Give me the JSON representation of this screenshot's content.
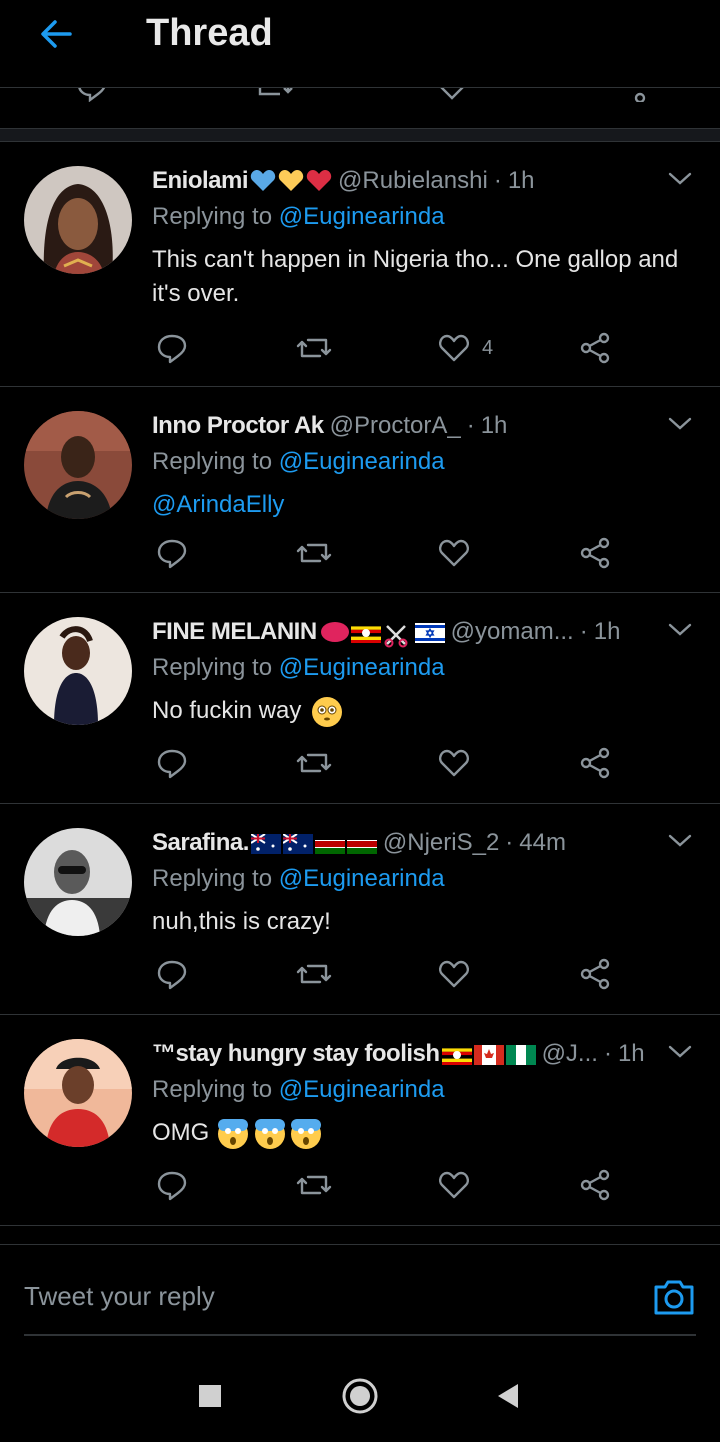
{
  "header": {
    "title": "Thread"
  },
  "tweets": [
    {
      "name": "Eniolami",
      "handle": "@Rubielanshi",
      "time": "1h",
      "replying_to_label": "Replying to",
      "replying_to": "@Euginearinda",
      "text": "This can't happen in Nigeria tho... One gallop and it's over.",
      "like_count": "4"
    },
    {
      "name": "Inno Proctor Ak",
      "handle": "@ProctorA_",
      "time": "1h",
      "replying_to_label": "Replying to",
      "replying_to": "@Euginearinda",
      "text": "@ArindaElly"
    },
    {
      "name": "FINE MELANIN",
      "handle": "@yomam...",
      "time": "1h",
      "replying_to_label": "Replying to",
      "replying_to": "@Euginearinda",
      "text": "No fuckin way"
    },
    {
      "name": "Sarafina.",
      "handle": "@NjeriS_2",
      "time": "44m",
      "replying_to_label": "Replying to",
      "replying_to": "@Euginearinda",
      "text": "nuh,this is crazy!"
    },
    {
      "name": "™stay hungry stay foolish",
      "handle": "@J...",
      "time": "1h",
      "replying_to_label": "Replying to",
      "replying_to": "@Euginearinda",
      "text": "OMG"
    }
  ],
  "reply_bar": {
    "placeholder": "Tweet your reply"
  },
  "colors": {
    "accent": "#1d9bf0",
    "muted": "#8b949b",
    "background": "#000000",
    "divider": "#2f3336"
  },
  "icons": [
    "back-arrow-icon",
    "chevron-down-icon",
    "reply-icon",
    "retweet-icon",
    "like-icon",
    "share-icon",
    "camera-icon",
    "square-icon",
    "circle-home-icon",
    "triangle-back-icon"
  ]
}
